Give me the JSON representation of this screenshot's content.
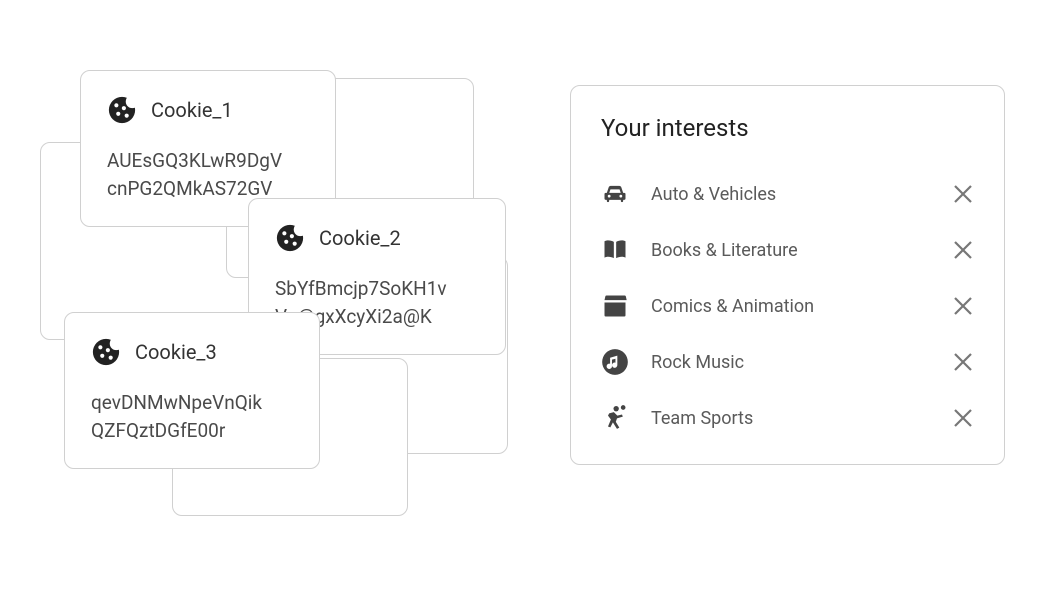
{
  "cookies": [
    {
      "title": "Cookie_1",
      "payload": "AUEsGQ3KLwR9DgV\ncnPG2QMkAS72GV"
    },
    {
      "title": "Cookie_2",
      "payload": "SbYfBmcjp7SoKH1v\nVo@gxXcyXi2a@K"
    },
    {
      "title": "Cookie_3",
      "payload": "qevDNMwNpeVnQik\nQZFQztDGfE00r"
    }
  ],
  "interests_panel": {
    "heading": "Your interests",
    "items": [
      {
        "icon": "car-icon",
        "label": "Auto & Vehicles"
      },
      {
        "icon": "book-icon",
        "label": "Books & Literature"
      },
      {
        "icon": "clapper-icon",
        "label": "Comics & Animation"
      },
      {
        "icon": "music-note-icon",
        "label": "Rock Music"
      },
      {
        "icon": "sports-icon",
        "label": "Team Sports"
      }
    ]
  }
}
